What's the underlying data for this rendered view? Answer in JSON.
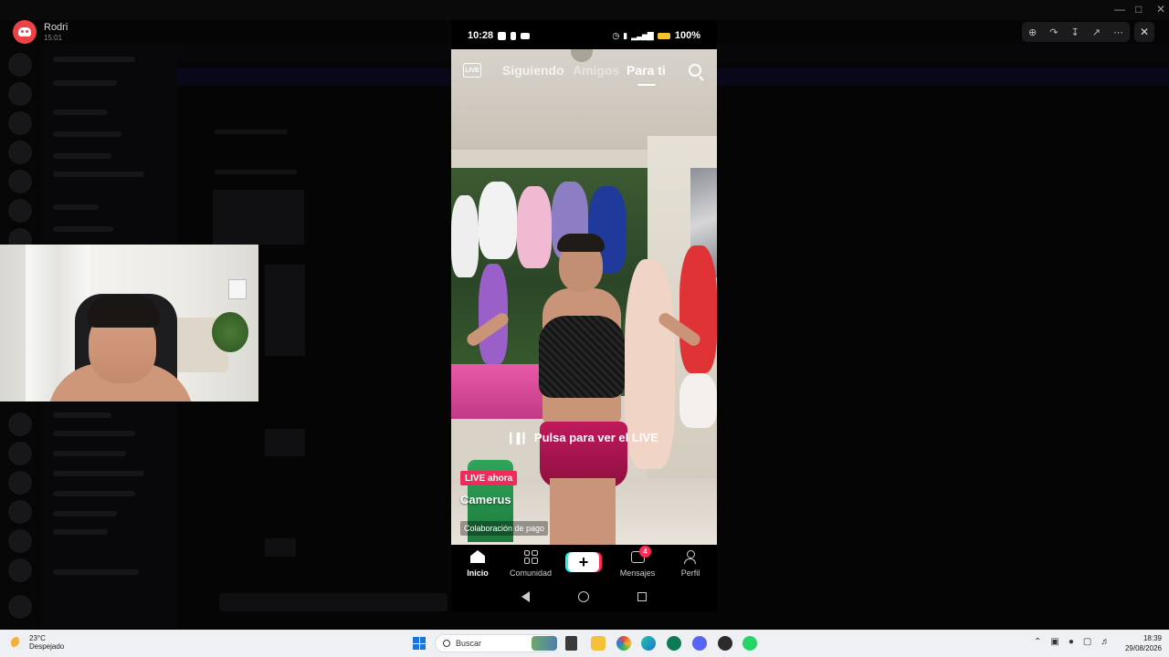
{
  "notification": {
    "sender": "Rodri",
    "time": "15:01"
  },
  "phone": {
    "status": {
      "time": "10:28",
      "battery": "100%"
    },
    "top_tabs": {
      "live": "LIVE",
      "following": "Siguiendo",
      "friends": "Amigos",
      "for_you": "Para ti"
    },
    "video": {
      "cta": "Pulsa para ver el LIVE",
      "live_badge": "LIVE ahora",
      "creator": "Camerus",
      "paid_label": "Colaboración de pago"
    },
    "bottom_nav": {
      "home": "Inicio",
      "community": "Comunidad",
      "create": "+",
      "messages": "Mensajes",
      "messages_badge": "4",
      "profile": "Perfil"
    }
  },
  "taskbar": {
    "weather_temp": "23°C",
    "weather_desc": "Despejado",
    "search_placeholder": "Buscar",
    "time": "18:39",
    "date": "29/08/2026"
  }
}
